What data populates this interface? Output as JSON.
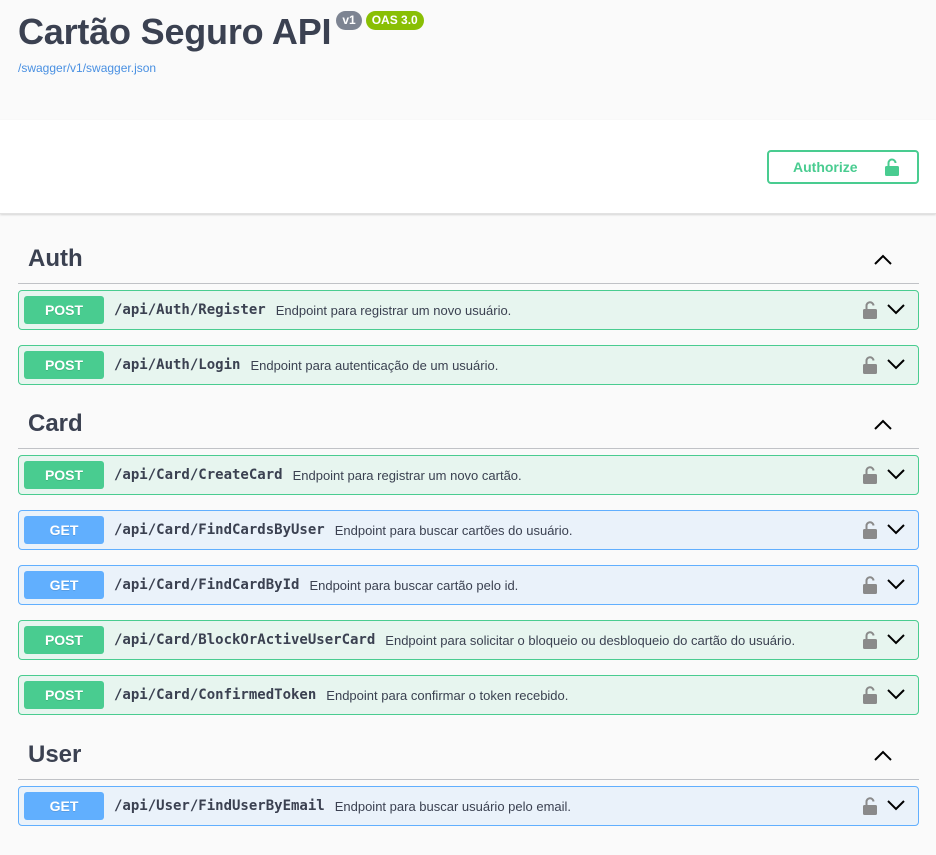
{
  "info": {
    "title": "Cartão Seguro API",
    "version_badge": "v1",
    "oas_badge": "OAS 3.0",
    "spec_link": "/swagger/v1/swagger.json"
  },
  "authorize": {
    "label": "Authorize",
    "icon": "unlocked-padlock-icon"
  },
  "colors": {
    "post": "#49cc90",
    "get": "#61affe",
    "text": "#3b4151",
    "link": "#4990e2",
    "version_badge": "#7d8492",
    "oas_badge": "#89bf04"
  },
  "tags": [
    {
      "name": "Auth",
      "expanded": true,
      "operations": [
        {
          "method": "POST",
          "path": "/api/Auth/Register",
          "summary": "Endpoint para registrar um novo usuário."
        },
        {
          "method": "POST",
          "path": "/api/Auth/Login",
          "summary": "Endpoint para autenticação de um usuário."
        }
      ]
    },
    {
      "name": "Card",
      "expanded": true,
      "operations": [
        {
          "method": "POST",
          "path": "/api/Card/CreateCard",
          "summary": "Endpoint para registrar um novo cartão."
        },
        {
          "method": "GET",
          "path": "/api/Card/FindCardsByUser",
          "summary": "Endpoint para buscar cartões do usuário."
        },
        {
          "method": "GET",
          "path": "/api/Card/FindCardById",
          "summary": "Endpoint para buscar cartão pelo id."
        },
        {
          "method": "POST",
          "path": "/api/Card/BlockOrActiveUserCard",
          "summary": "Endpoint para solicitar o bloqueio ou desbloqueio do cartão do usuário."
        },
        {
          "method": "POST",
          "path": "/api/Card/ConfirmedToken",
          "summary": "Endpoint para confirmar o token recebido."
        }
      ]
    },
    {
      "name": "User",
      "expanded": true,
      "operations": [
        {
          "method": "GET",
          "path": "/api/User/FindUserByEmail",
          "summary": "Endpoint para buscar usuário pelo email."
        }
      ]
    }
  ]
}
